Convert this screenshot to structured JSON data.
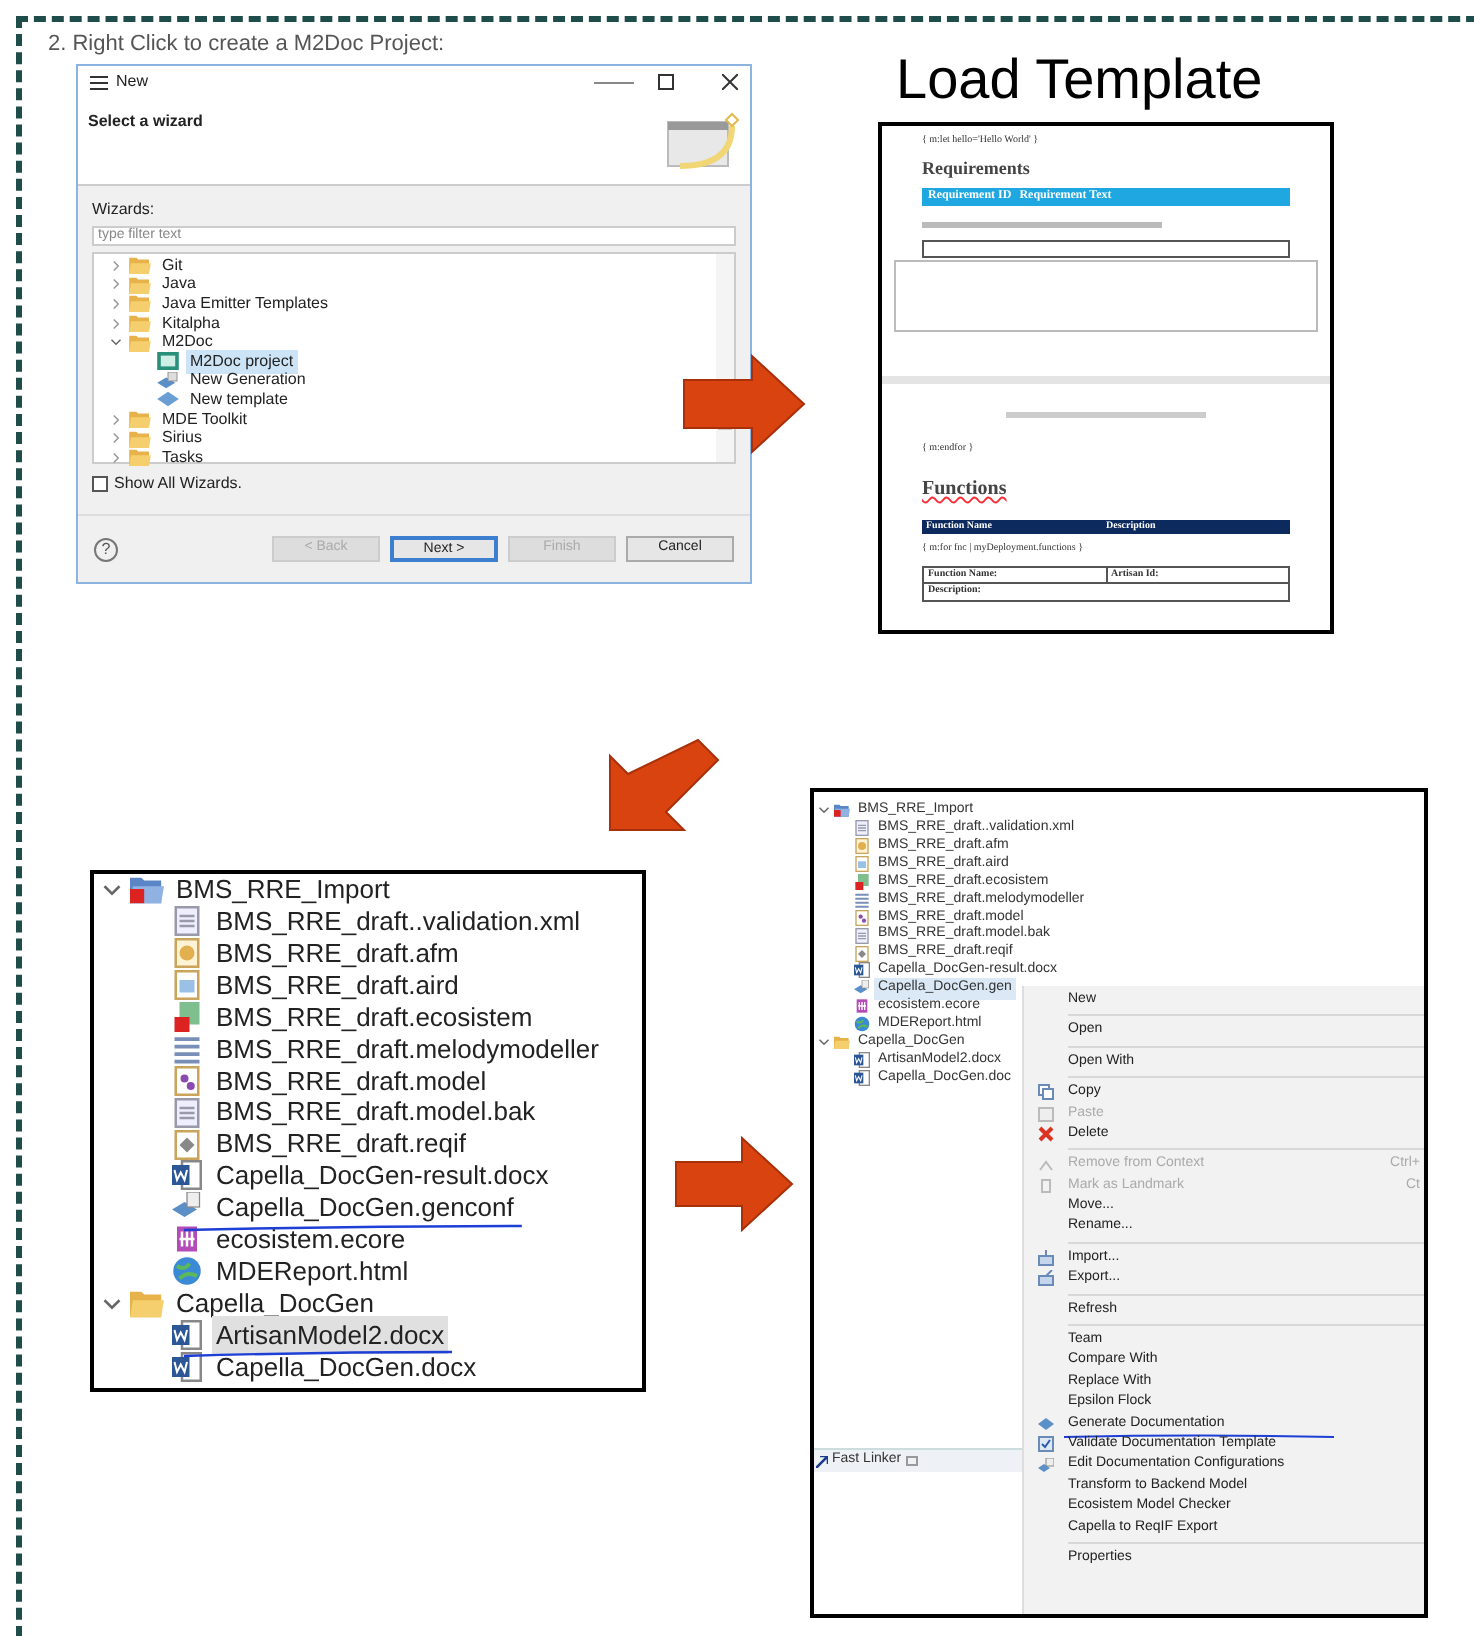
{
  "caption": "2. Right Click to create a M2Doc Project:",
  "wizard": {
    "title": "New",
    "heading": "Select a wizard",
    "wizards_label": "Wizards:",
    "filter": {
      "placeholder": "type filter text"
    },
    "tree": [
      {
        "label": "Git",
        "kind": "folder",
        "expanded": false,
        "selected": false
      },
      {
        "label": "Java",
        "kind": "folder",
        "expanded": false,
        "selected": false
      },
      {
        "label": "Java Emitter Templates",
        "kind": "folder",
        "expanded": false,
        "selected": false
      },
      {
        "label": "Kitalpha",
        "kind": "folder",
        "expanded": false,
        "selected": false
      },
      {
        "label": "M2Doc",
        "kind": "folder",
        "expanded": true,
        "selected": false,
        "children": [
          {
            "label": "M2Doc project",
            "kind": "project_wizard",
            "selected": true
          },
          {
            "label": "New Generation",
            "kind": "generation",
            "selected": false
          },
          {
            "label": "New template",
            "kind": "template",
            "selected": false
          }
        ]
      },
      {
        "label": "MDE Toolkit",
        "kind": "folder",
        "expanded": false,
        "selected": false
      },
      {
        "label": "Sirius",
        "kind": "folder",
        "expanded": false,
        "selected": false
      },
      {
        "label": "Tasks",
        "kind": "folder",
        "expanded": false,
        "selected": false
      }
    ],
    "show_all": {
      "label": "Show All Wizards.",
      "checked": false
    },
    "help": "?",
    "buttons": [
      {
        "label": "< Back",
        "disabled": true,
        "default": false
      },
      {
        "label": "Next >",
        "disabled": false,
        "default": true
      },
      {
        "label": "Finish",
        "disabled": true,
        "default": false
      },
      {
        "label": "Cancel",
        "disabled": false,
        "default": false
      }
    ]
  },
  "template": {
    "title": "Load Template",
    "doc": {
      "let_line": "{ m:let hello='Hello World' }",
      "req_heading": "Requirements",
      "req_columns": [
        "Requirement ID",
        "Requirement Text"
      ],
      "endfor": "{ m:endfor }",
      "fn_heading": "Functions",
      "fn_columns": [
        "Function Name",
        "Description"
      ],
      "fn_for": "{ m:for fnc | myDeployment.functions }",
      "fn_fields": [
        "Function Name:",
        "Artisan Id:"
      ],
      "fn_desc": "Description:"
    }
  },
  "explorer": {
    "tree": [
      {
        "label": "BMS_RRE_Import",
        "kind": "project",
        "expanded": true,
        "selected": false,
        "underlined": false,
        "children": [
          {
            "label": "BMS_RRE_draft..validation.xml",
            "kind": "text_file",
            "selected": false,
            "underlined": false
          },
          {
            "label": "BMS_RRE_draft.afm",
            "kind": "afm_file",
            "selected": false,
            "underlined": false
          },
          {
            "label": "BMS_RRE_draft.aird",
            "kind": "aird_file",
            "selected": false,
            "underlined": false
          },
          {
            "label": "BMS_RRE_draft.ecosistem",
            "kind": "error_model",
            "selected": false,
            "underlined": false
          },
          {
            "label": "BMS_RRE_draft.melodymodeller",
            "kind": "lines_file",
            "selected": false,
            "underlined": false
          },
          {
            "label": "BMS_RRE_draft.model",
            "kind": "model_file",
            "selected": false,
            "underlined": false
          },
          {
            "label": "BMS_RRE_draft.model.bak",
            "kind": "text_file",
            "selected": false,
            "underlined": false
          },
          {
            "label": "BMS_RRE_draft.reqif",
            "kind": "reqif_file",
            "selected": false,
            "underlined": false
          },
          {
            "label": "Capella_DocGen-result.docx",
            "kind": "word_file",
            "selected": false,
            "underlined": false
          },
          {
            "label": "Capella_DocGen.genconf",
            "kind": "genconf_file",
            "selected": false,
            "underlined": true
          },
          {
            "label": "ecosistem.ecore",
            "kind": "ecore_file",
            "selected": false,
            "underlined": false
          },
          {
            "label": "MDEReport.html",
            "kind": "html_file",
            "selected": false,
            "underlined": false
          }
        ]
      },
      {
        "label": "Capella_DocGen",
        "kind": "folder",
        "expanded": true,
        "selected": false,
        "underlined": false,
        "children": [
          {
            "label": "ArtisanModel2.docx",
            "kind": "word_file",
            "selected": true,
            "underlined": true
          },
          {
            "label": "Capella_DocGen.docx",
            "kind": "word_file",
            "selected": false,
            "underlined": false
          }
        ]
      }
    ]
  },
  "context": {
    "tree": [
      {
        "label": "BMS_RRE_Import",
        "kind": "project",
        "expanded": true,
        "selected": false,
        "children": [
          {
            "label": "BMS_RRE_draft..validation.xml",
            "kind": "text_file",
            "selected": false
          },
          {
            "label": "BMS_RRE_draft.afm",
            "kind": "afm_file",
            "selected": false
          },
          {
            "label": "BMS_RRE_draft.aird",
            "kind": "aird_file",
            "selected": false
          },
          {
            "label": "BMS_RRE_draft.ecosistem",
            "kind": "error_model",
            "selected": false
          },
          {
            "label": "BMS_RRE_draft.melodymodeller",
            "kind": "lines_file",
            "selected": false
          },
          {
            "label": "BMS_RRE_draft.model",
            "kind": "model_file",
            "selected": false
          },
          {
            "label": "BMS_RRE_draft.model.bak",
            "kind": "text_file",
            "selected": false
          },
          {
            "label": "BMS_RRE_draft.reqif",
            "kind": "reqif_file",
            "selected": false
          },
          {
            "label": "Capella_DocGen-result.docx",
            "kind": "word_file",
            "selected": false
          },
          {
            "label": "Capella_DocGen.gen",
            "kind": "genconf_file",
            "selected": true
          },
          {
            "label": "ecosistem.ecore",
            "kind": "ecore_file",
            "selected": false
          },
          {
            "label": "MDEReport.html",
            "kind": "html_file",
            "selected": false
          }
        ]
      },
      {
        "label": "Capella_DocGen",
        "kind": "folder",
        "expanded": true,
        "selected": false,
        "children": [
          {
            "label": "ArtisanModel2.docx",
            "kind": "word_file",
            "selected": false
          },
          {
            "label": "Capella_DocGen.doc",
            "kind": "word_file",
            "selected": false
          }
        ]
      }
    ],
    "view_tab": "Fast Linker",
    "menu": [
      {
        "kind": "plain",
        "label": "New",
        "disabled": false
      },
      {
        "kind": "separator"
      },
      {
        "kind": "plain",
        "label": "Open",
        "disabled": false
      },
      {
        "kind": "separator"
      },
      {
        "kind": "plain",
        "label": "Open With",
        "disabled": false
      },
      {
        "kind": "separator"
      },
      {
        "kind": "copy",
        "label": "Copy",
        "disabled": false
      },
      {
        "kind": "paste",
        "label": "Paste",
        "disabled": true
      },
      {
        "kind": "delete",
        "label": "Delete",
        "disabled": false
      },
      {
        "kind": "separator"
      },
      {
        "kind": "remove",
        "label": "Remove from Context",
        "disabled": true,
        "shortcut": "Ctrl+"
      },
      {
        "kind": "landmark",
        "label": "Mark as Landmark",
        "disabled": true,
        "shortcut": "Ct"
      },
      {
        "kind": "plain",
        "label": "Move...",
        "disabled": false
      },
      {
        "kind": "plain",
        "label": "Rename...",
        "disabled": false
      },
      {
        "kind": "separator"
      },
      {
        "kind": "import",
        "label": "Import...",
        "disabled": false
      },
      {
        "kind": "export",
        "label": "Export...",
        "disabled": false
      },
      {
        "kind": "separator"
      },
      {
        "kind": "plain",
        "label": "Refresh",
        "disabled": false
      },
      {
        "kind": "separator"
      },
      {
        "kind": "plain",
        "label": "Team",
        "disabled": false
      },
      {
        "kind": "plain",
        "label": "Compare With",
        "disabled": false
      },
      {
        "kind": "plain",
        "label": "Replace With",
        "disabled": false
      },
      {
        "kind": "plain",
        "label": "Epsilon Flock",
        "disabled": false
      },
      {
        "kind": "generate",
        "label": "Generate Documentation",
        "disabled": false,
        "underlined": true
      },
      {
        "kind": "validate",
        "label": "Validate Documentation Template",
        "disabled": false
      },
      {
        "kind": "edit",
        "label": "Edit Documentation Configurations",
        "disabled": false
      },
      {
        "kind": "plain",
        "label": "Transform to Backend Model",
        "disabled": false
      },
      {
        "kind": "plain",
        "label": "Ecosistem Model Checker",
        "disabled": false
      },
      {
        "kind": "plain",
        "label": "Capella to ReqIF Export",
        "disabled": false
      },
      {
        "kind": "separator"
      },
      {
        "kind": "plain",
        "label": "Properties",
        "disabled": false
      }
    ]
  }
}
